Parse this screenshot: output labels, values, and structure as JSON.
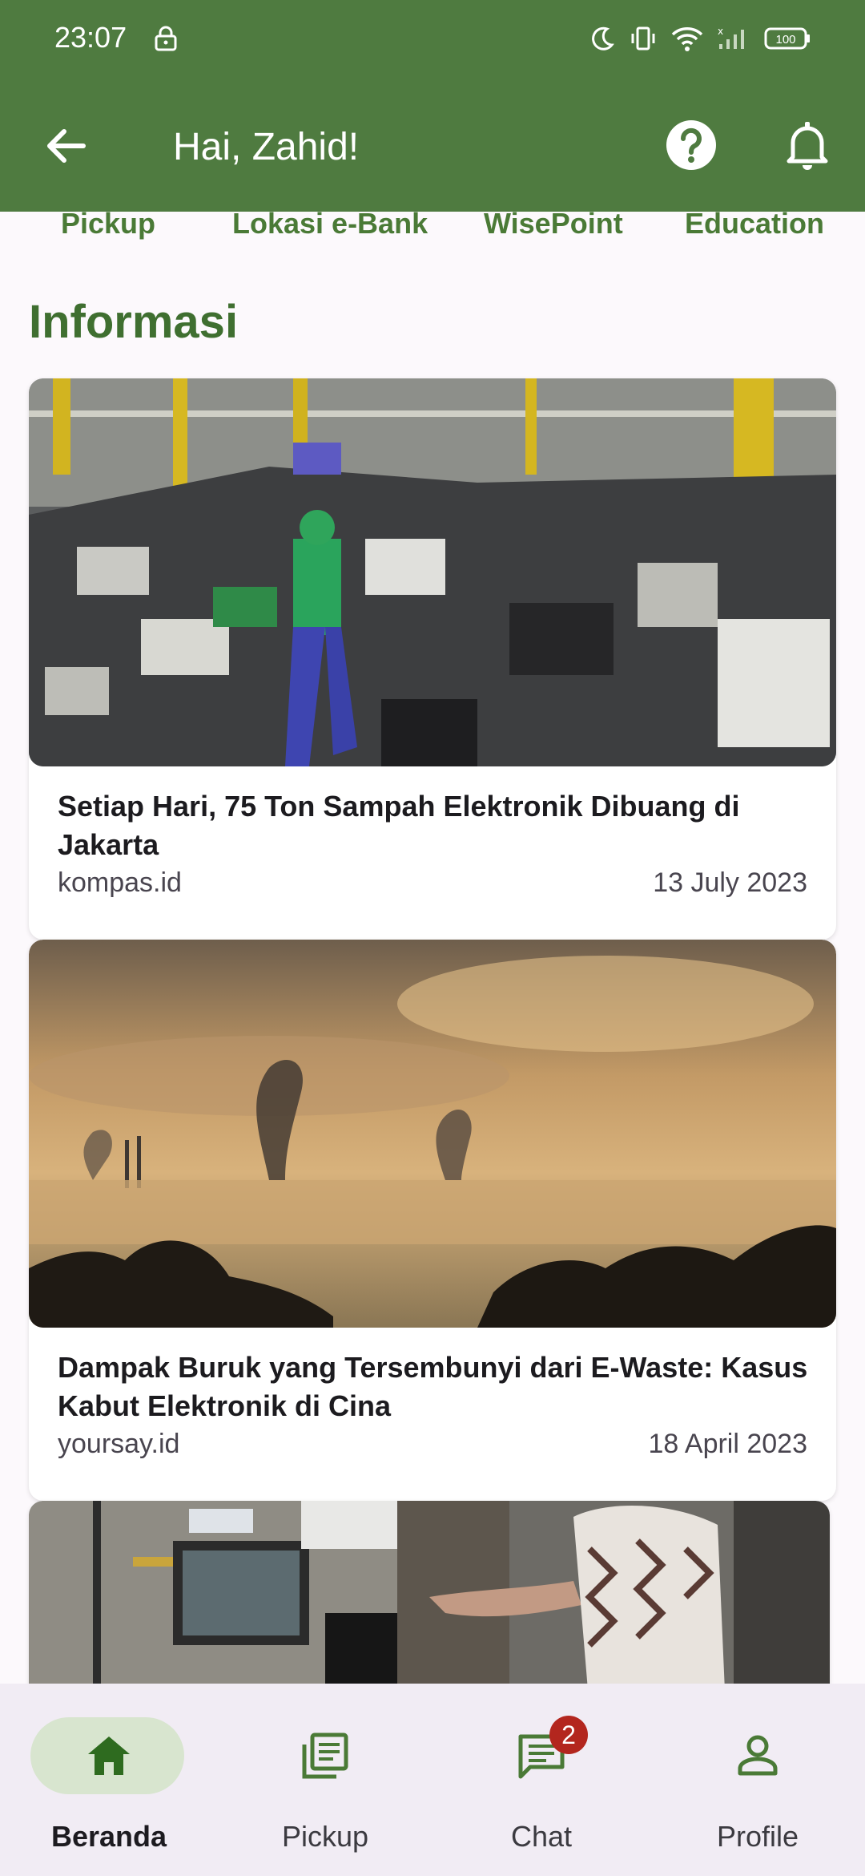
{
  "status_bar": {
    "time": "23:07",
    "battery": "100"
  },
  "app_bar": {
    "greeting": "Hai, Zahid!"
  },
  "categories": [
    "Pickup",
    "Lokasi e-Bank",
    "WisePoint",
    "Education"
  ],
  "section_title": "Informasi",
  "articles": [
    {
      "title": "Setiap Hari, 75 Ton Sampah Elektronik Dibuang di Jakarta",
      "source": "kompas.id",
      "date": "13 July 2023"
    },
    {
      "title": "Dampak Buruk yang Tersembunyi dari E-Waste: Kasus Kabut Elektronik di Cina",
      "source": "yoursay.id",
      "date": "18 April 2023"
    }
  ],
  "bottom_nav": [
    {
      "label": "Beranda",
      "icon": "home-icon",
      "active": true
    },
    {
      "label": "Pickup",
      "icon": "list-icon",
      "active": false
    },
    {
      "label": "Chat",
      "icon": "chat-icon",
      "active": false,
      "badge": "2"
    },
    {
      "label": "Profile",
      "icon": "person-icon",
      "active": false
    }
  ],
  "colors": {
    "primary": "#4f7b40",
    "accent_text": "#4a7a36",
    "nav_bg": "#f1ecf4",
    "nav_pill": "#d8e5cf",
    "badge": "#b3261e"
  }
}
